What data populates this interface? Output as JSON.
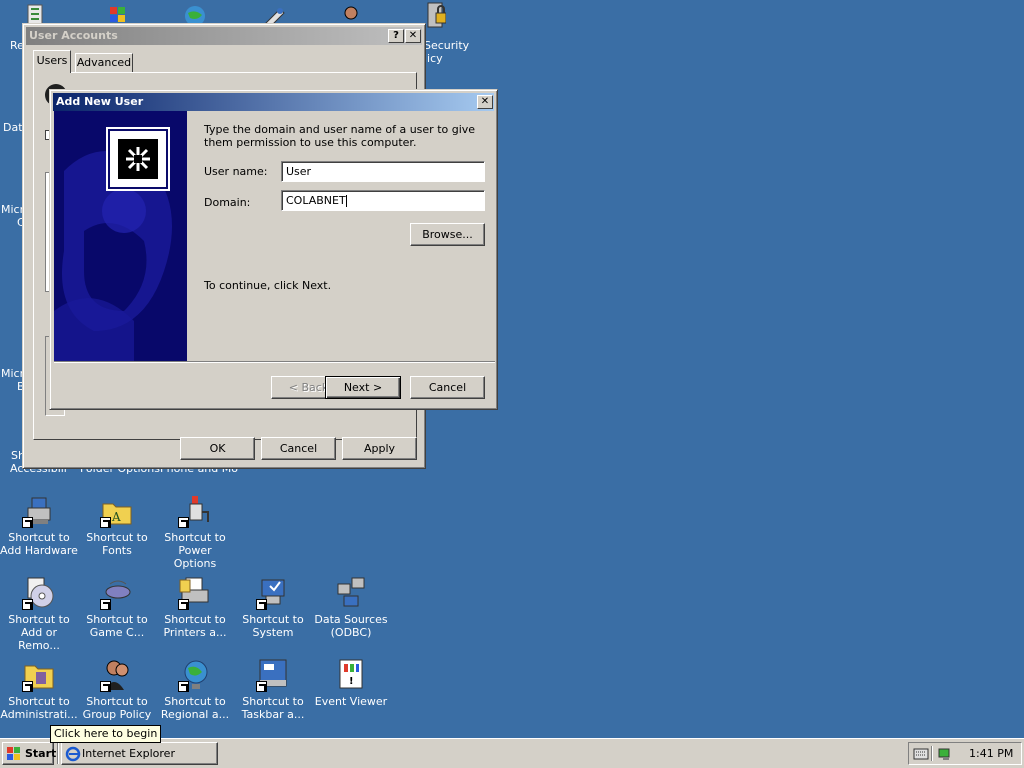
{
  "desktop": {
    "top_fragments": {
      "left": "Re",
      "security": "Security",
      "policy": "licy",
      "data": "Data",
      "micro1": "Micro",
      "micro1b": "C",
      "micro2": "Micro",
      "micro2b": "B",
      "sh": "Sh",
      "accessibility": "Accessibili",
      "folder": "Folder Options",
      "phone": "Phone and Mo"
    },
    "icons": [
      {
        "name": "add-hardware",
        "line1": "Shortcut to",
        "line2": "Add Hardware",
        "icon": "add-hardware-icon"
      },
      {
        "name": "fonts",
        "line1": "Shortcut to",
        "line2": "Fonts",
        "icon": "fonts-folder-icon"
      },
      {
        "name": "power-options",
        "line1": "Shortcut to",
        "line2": "Power Options",
        "icon": "power-options-icon"
      },
      {
        "name": "add-remove",
        "line1": "Shortcut to",
        "line2": "Add or Remo...",
        "icon": "add-remove-programs-icon"
      },
      {
        "name": "game-controllers",
        "line1": "Shortcut to",
        "line2": "Game C...",
        "icon": "game-controller-icon"
      },
      {
        "name": "printers",
        "line1": "Shortcut to",
        "line2": "Printers a...",
        "icon": "printer-icon"
      },
      {
        "name": "system",
        "line1": "Shortcut to",
        "line2": "System",
        "icon": "system-icon"
      },
      {
        "name": "odbc",
        "line1": "Data Sources",
        "line2": "(ODBC)",
        "icon": "odbc-icon"
      },
      {
        "name": "admin-tools",
        "line1": "Shortcut to",
        "line2": "Administrati...",
        "icon": "administrative-tools-icon"
      },
      {
        "name": "group-policy",
        "line1": "Shortcut to",
        "line2": "Group Policy",
        "icon": "group-policy-icon"
      },
      {
        "name": "regional",
        "line1": "Shortcut to",
        "line2": "Regional a...",
        "icon": "globe-icon"
      },
      {
        "name": "taskbar",
        "line1": "Shortcut to",
        "line2": "Taskbar a...",
        "icon": "taskbar-icon"
      },
      {
        "name": "event-viewer",
        "line1": "Event Viewer",
        "line2": "",
        "icon": "event-viewer-icon"
      }
    ]
  },
  "user_accounts": {
    "title": "User Accounts",
    "tabs": [
      "Users",
      "Advanced"
    ],
    "ok": "OK",
    "cancel": "Cancel",
    "apply": "Apply"
  },
  "add_user": {
    "title": "Add New User",
    "instructions": "Type the domain and user name of a user to give them permission to use this computer.",
    "username_label": "User name:",
    "username_value": "User",
    "domain_label": "Domain:",
    "domain_value": "COLABNET",
    "browse": "Browse...",
    "continue_text": "To continue, click Next.",
    "back": "< Back",
    "next": "Next >",
    "cancel": "Cancel"
  },
  "taskbar": {
    "start": "Start",
    "task": "Internet Explorer cannot...",
    "clock": "1:41 PM",
    "tooltip": "Click here to begin"
  },
  "colors": {
    "desktop": "#3a6ea5",
    "title_active": "#0a246a",
    "face": "#d4d0c8"
  }
}
